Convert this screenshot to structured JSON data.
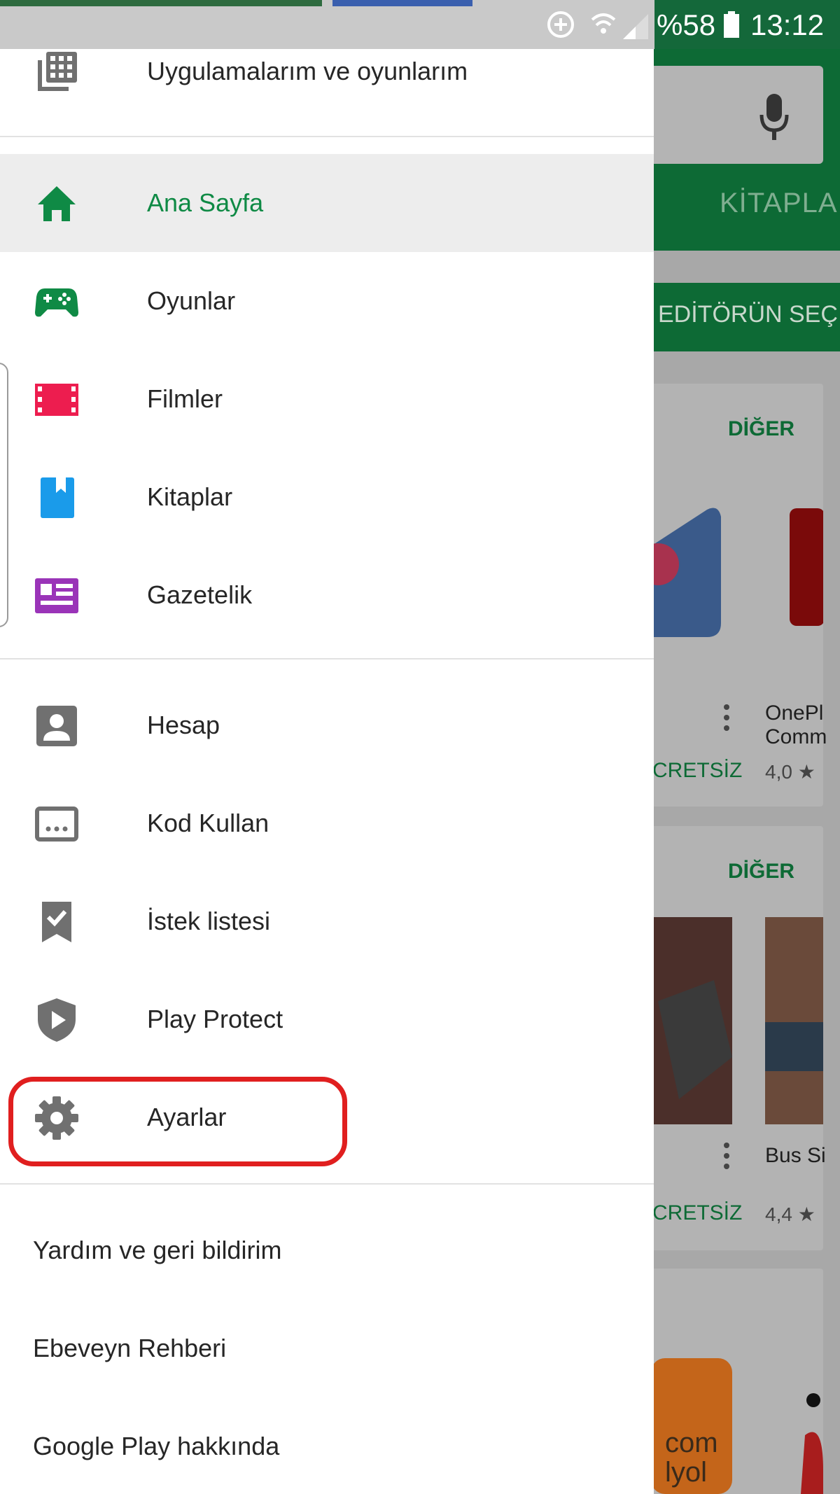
{
  "status_bar": {
    "battery": "%58",
    "time": "13:12",
    "icons": [
      "data-saver-icon",
      "wifi-icon",
      "signal-icon",
      "battery-icon"
    ]
  },
  "drawer": {
    "top_item": {
      "label": "Uygulamalarım ve oyunlarım",
      "icon": "apps-grid-icon"
    },
    "primary_items": [
      {
        "label": "Ana Sayfa",
        "icon": "home-icon",
        "color": "#0f8a45",
        "active": true
      },
      {
        "label": "Oyunlar",
        "icon": "gamepad-icon",
        "color": "#0f8a45"
      },
      {
        "label": "Filmler",
        "icon": "film-icon",
        "color": "#ed1d4f"
      },
      {
        "label": "Kitaplar",
        "icon": "book-icon",
        "color": "#1a9bea"
      },
      {
        "label": "Gazetelik",
        "icon": "newsstand-icon",
        "color": "#9a34b8"
      }
    ],
    "account_items": [
      {
        "label": "Hesap",
        "icon": "account-icon"
      },
      {
        "label": "Kod Kullan",
        "icon": "redeem-code-icon"
      },
      {
        "label": "İstek listesi",
        "icon": "wishlist-icon"
      },
      {
        "label": "Play Protect",
        "icon": "play-protect-icon"
      },
      {
        "label": "Ayarlar",
        "icon": "settings-gear-icon",
        "highlighted": true
      }
    ],
    "footer_items": [
      {
        "label": "Yardım ve geri bildirim"
      },
      {
        "label": "Ebeveyn Rehberi"
      },
      {
        "label": "Google Play hakkında"
      }
    ],
    "highlight_color": "#e01f1f"
  },
  "background": {
    "tab_label": "KİTAPLA",
    "chip_label": "EDİTÖRÜN SEÇİ",
    "cards": [
      {
        "more_label": "DİĞER",
        "price_label": "CRETSİZ",
        "app_name": "OnePl\nComm",
        "rating": "4,0 ★"
      },
      {
        "more_label": "DİĞER",
        "price_label": "CRETSİZ",
        "app_name": "Bus Si",
        "rating": "4,4 ★"
      }
    ],
    "third_card_text": "com\nlyol",
    "accent_color": "#0d6a35"
  }
}
